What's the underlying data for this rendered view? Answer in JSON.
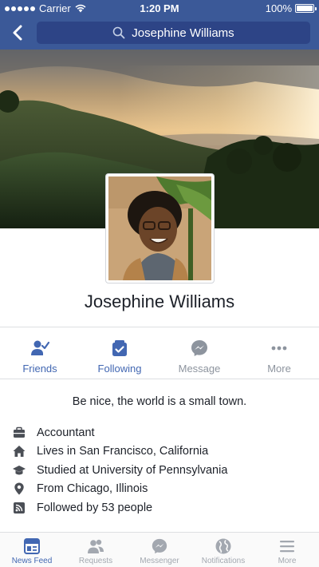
{
  "status_bar": {
    "carrier": "Carrier",
    "time": "1:20 PM",
    "battery": "100%"
  },
  "header": {
    "search_text": "Josephine Williams",
    "accent": "#3b5998"
  },
  "profile": {
    "name": "Josephine Williams",
    "bio": "Be nice, the world is a small town."
  },
  "actions": [
    {
      "label": "Friends",
      "icon": "friend-check-icon",
      "active": true
    },
    {
      "label": "Following",
      "icon": "following-icon",
      "active": true
    },
    {
      "label": "Message",
      "icon": "messenger-icon",
      "active": false
    },
    {
      "label": "More",
      "icon": "more-dots-icon",
      "active": false
    }
  ],
  "info": [
    {
      "text": "Accountant",
      "icon": "briefcase-icon"
    },
    {
      "text": "Lives in San Francisco, California",
      "icon": "home-icon"
    },
    {
      "text": "Studied at University of Pennsylvania",
      "icon": "graduation-cap-icon"
    },
    {
      "text": "From Chicago, Illinois",
      "icon": "location-pin-icon"
    },
    {
      "text": "Followed by 53 people",
      "icon": "rss-icon"
    }
  ],
  "tabs": [
    {
      "label": "News Feed",
      "icon": "news-feed-icon",
      "active": true
    },
    {
      "label": "Requests",
      "icon": "requests-icon",
      "active": false
    },
    {
      "label": "Messenger",
      "icon": "messenger-icon",
      "active": false
    },
    {
      "label": "Notifications",
      "icon": "globe-icon",
      "active": false
    },
    {
      "label": "More",
      "icon": "menu-icon",
      "active": false
    }
  ]
}
